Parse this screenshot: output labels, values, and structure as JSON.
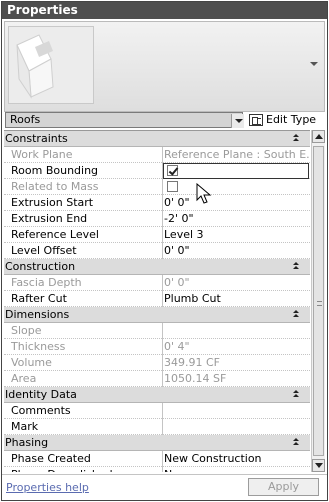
{
  "window": {
    "title": "Properties"
  },
  "type_selector": {
    "value": "Roofs",
    "edit_type_label": "Edit Type"
  },
  "groups": [
    {
      "label": "Constraints",
      "rows": [
        {
          "name": "Work Plane",
          "value": "Reference Plane : South E...",
          "dim": true
        },
        {
          "name": "Room Bounding",
          "value": "",
          "checkbox": true,
          "checked": true,
          "editing": true
        },
        {
          "name": "Related to Mass",
          "value": "",
          "checkbox": true,
          "checked": false,
          "dim": true
        },
        {
          "name": "Extrusion Start",
          "value": "0'  0\""
        },
        {
          "name": "Extrusion End",
          "value": "-2'  0\""
        },
        {
          "name": "Reference Level",
          "value": "Level 3"
        },
        {
          "name": "Level Offset",
          "value": "0'  0\""
        }
      ]
    },
    {
      "label": "Construction",
      "rows": [
        {
          "name": "Fascia Depth",
          "value": "0'  0\"",
          "dim": true
        },
        {
          "name": "Rafter Cut",
          "value": "Plumb Cut"
        }
      ]
    },
    {
      "label": "Dimensions",
      "rows": [
        {
          "name": "Slope",
          "value": "",
          "dim": true
        },
        {
          "name": "Thickness",
          "value": "0'  4\"",
          "dim": true
        },
        {
          "name": "Volume",
          "value": "349.91 CF",
          "dim": true
        },
        {
          "name": "Area",
          "value": "1050.14 SF",
          "dim": true
        }
      ]
    },
    {
      "label": "Identity Data",
      "rows": [
        {
          "name": "Comments",
          "value": ""
        },
        {
          "name": "Mark",
          "value": ""
        }
      ]
    },
    {
      "label": "Phasing",
      "rows": [
        {
          "name": "Phase Created",
          "value": "New Construction"
        },
        {
          "name": "Phase Demolished",
          "value": "None"
        }
      ]
    }
  ],
  "footer": {
    "help_label": "Properties help",
    "apply_label": "Apply"
  },
  "icons": {
    "collapse": "collapse-group-icon",
    "edit_type": "edit-type-icon",
    "cursor": "mouse-pointer-icon"
  }
}
